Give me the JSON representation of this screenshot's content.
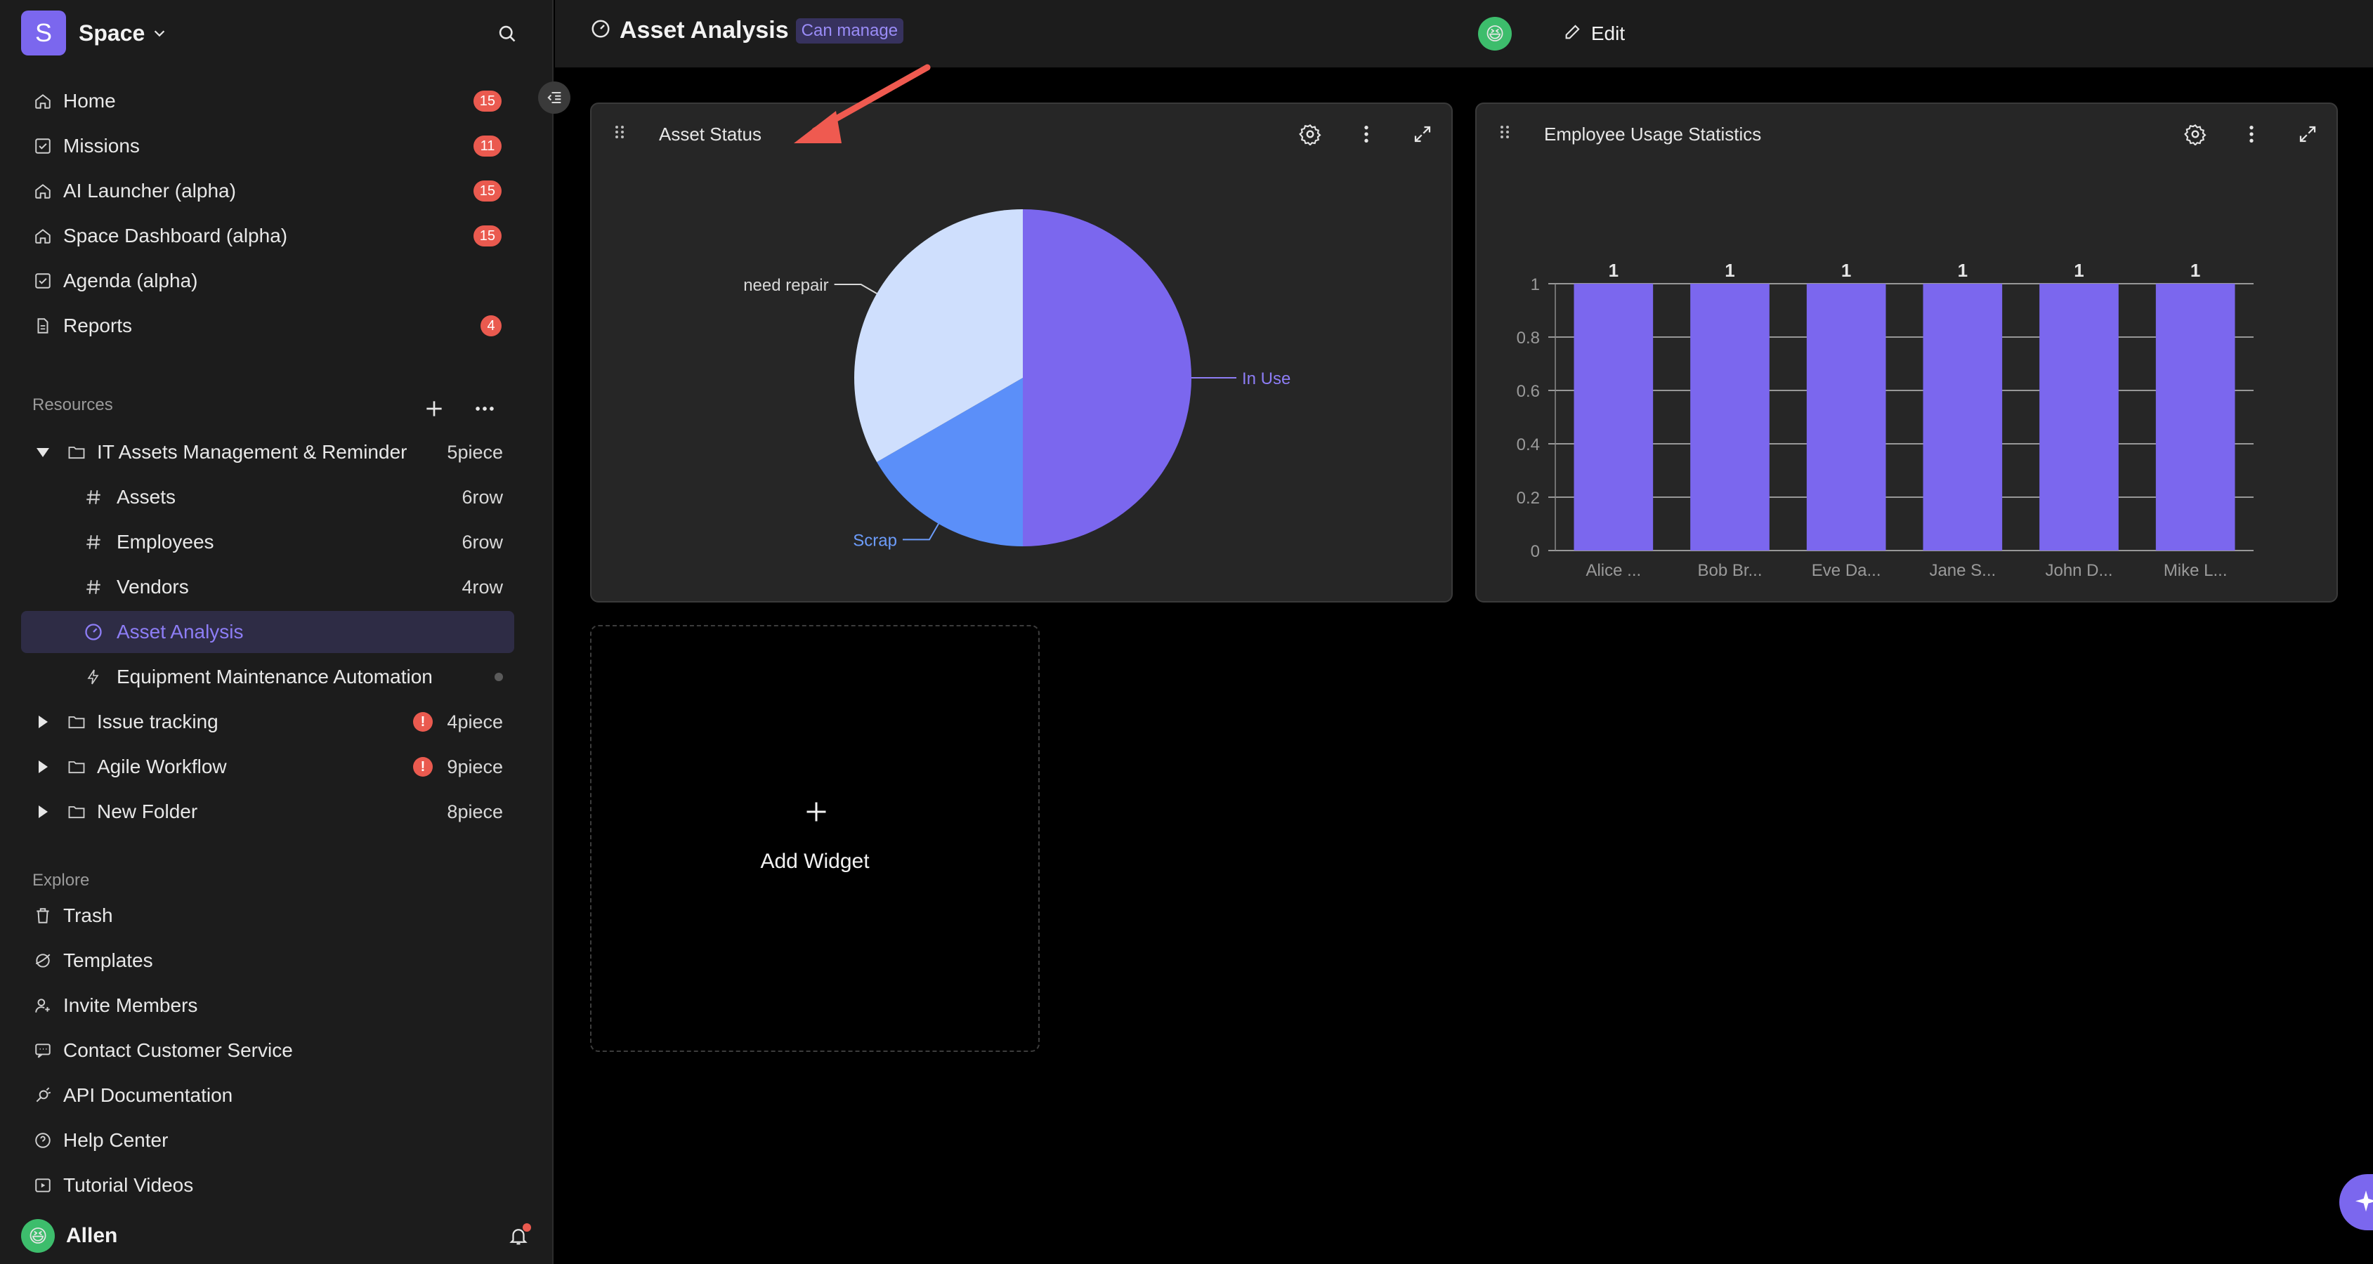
{
  "sidebar": {
    "space_initial": "S",
    "space_name": "Space",
    "nav": [
      {
        "label": "Home",
        "badge": "15",
        "icon": "home-icon"
      },
      {
        "label": "Missions",
        "badge": "11",
        "icon": "checkbox-icon"
      },
      {
        "label": "AI Launcher (alpha)",
        "badge": "15",
        "icon": "home-icon"
      },
      {
        "label": "Space Dashboard (alpha)",
        "badge": "15",
        "icon": "home-icon"
      },
      {
        "label": "Agenda (alpha)",
        "badge": "",
        "icon": "checkbox-icon"
      },
      {
        "label": "Reports",
        "badge": "4",
        "icon": "document-icon"
      }
    ],
    "resources_label": "Resources",
    "tree": [
      {
        "label": "IT Assets Management & Reminder",
        "meta": "5piece"
      },
      {
        "label": "Assets",
        "meta": "6row"
      },
      {
        "label": "Employees",
        "meta": "6row"
      },
      {
        "label": "Vendors",
        "meta": "4row"
      },
      {
        "label": "Asset Analysis",
        "meta": ""
      },
      {
        "label": "Equipment Maintenance Automation",
        "meta": ""
      },
      {
        "label": "Issue tracking",
        "meta": "4piece",
        "warning": "!"
      },
      {
        "label": "Agile Workflow",
        "meta": "9piece",
        "warning": "!"
      },
      {
        "label": "New Folder",
        "meta": "8piece"
      }
    ],
    "explore_label": "Explore",
    "explore": [
      {
        "label": "Trash",
        "icon": "trash-icon"
      },
      {
        "label": "Templates",
        "icon": "templates-icon"
      },
      {
        "label": "Invite Members",
        "icon": "invite-icon"
      },
      {
        "label": "Contact Customer Service",
        "icon": "chat-icon"
      },
      {
        "label": "API Documentation",
        "icon": "api-icon"
      },
      {
        "label": "Help Center",
        "icon": "help-icon"
      },
      {
        "label": "Tutorial Videos",
        "icon": "video-icon"
      }
    ],
    "user_name": "Allen",
    "user_avatar": "😆"
  },
  "topbar": {
    "title": "Asset Analysis",
    "permission": "Can manage",
    "edit_label": "Edit",
    "avatar": "😆"
  },
  "widgets": {
    "asset_status_title": "Asset Status",
    "usage_title": "Employee Usage Statistics",
    "add_widget_label": "Add Widget"
  },
  "colors": {
    "accent": "#7b67ee",
    "pie_in_use": "#7b67ee",
    "pie_scrap": "#5b8ff9",
    "pie_need_repair": "#cfdffd",
    "badge": "#ea5a4f"
  },
  "chart_data": [
    {
      "type": "pie",
      "title": "Asset Status",
      "slices": [
        {
          "label": "In Use",
          "value": 3
        },
        {
          "label": "Scrap",
          "value": 1
        },
        {
          "label": "need repair",
          "value": 2
        }
      ]
    },
    {
      "type": "bar",
      "title": "Employee Usage Statistics",
      "categories": [
        "Alice ...",
        "Bob Br...",
        "Eve Da...",
        "Jane S...",
        "John D...",
        "Mike L..."
      ],
      "values": [
        1,
        1,
        1,
        1,
        1,
        1
      ],
      "ylim": [
        0,
        1
      ],
      "yticks": [
        "0",
        "0.2",
        "0.4",
        "0.6",
        "0.8",
        "1"
      ],
      "grid": true
    }
  ]
}
